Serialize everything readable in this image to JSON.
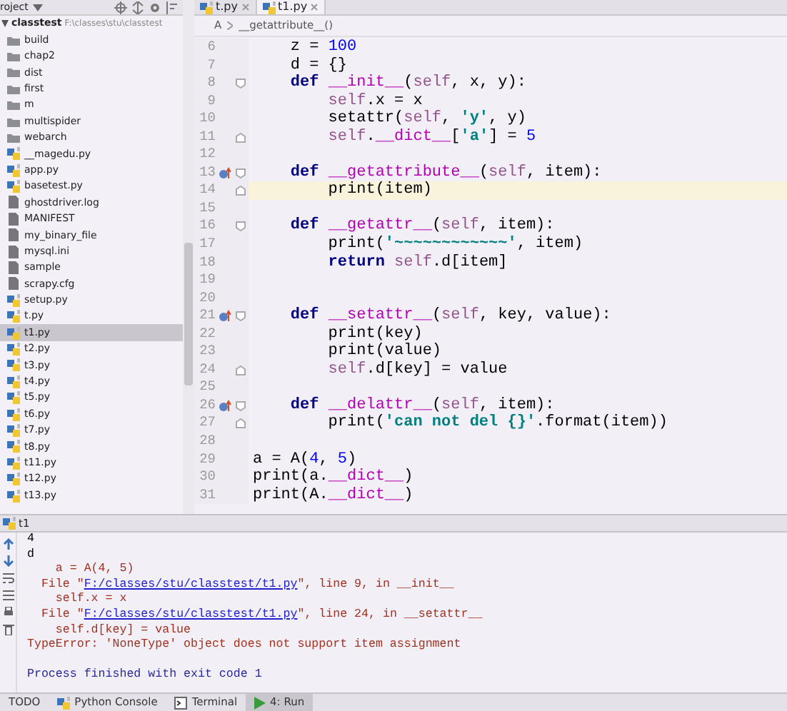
{
  "project": {
    "title": "roject",
    "root": {
      "label": "classtest",
      "path": "F:\\classes\\stu\\classtest",
      "expanded": true,
      "children": [
        {
          "label": "build",
          "kind": "folder",
          "selected": false
        },
        {
          "label": "chap2",
          "kind": "folder",
          "selected": false
        },
        {
          "label": "dist",
          "kind": "folder",
          "selected": false
        },
        {
          "label": "first",
          "kind": "folder",
          "selected": false
        },
        {
          "label": "m",
          "kind": "folder",
          "selected": false
        },
        {
          "label": "multispider",
          "kind": "folder",
          "selected": false
        },
        {
          "label": "webarch",
          "kind": "folder",
          "selected": false
        },
        {
          "label": "__magedu.py",
          "kind": "python",
          "selected": false
        },
        {
          "label": "app.py",
          "kind": "python",
          "selected": false
        },
        {
          "label": "basetest.py",
          "kind": "python",
          "selected": false
        },
        {
          "label": "ghostdriver.log",
          "kind": "file",
          "selected": false
        },
        {
          "label": "MANIFEST",
          "kind": "file",
          "selected": false
        },
        {
          "label": "my_binary_file",
          "kind": "file",
          "selected": false
        },
        {
          "label": "mysql.ini",
          "kind": "file",
          "selected": false
        },
        {
          "label": "sample",
          "kind": "file",
          "selected": false
        },
        {
          "label": "scrapy.cfg",
          "kind": "file",
          "selected": false
        },
        {
          "label": "setup.py",
          "kind": "python",
          "selected": false
        },
        {
          "label": "t.py",
          "kind": "python",
          "selected": false
        },
        {
          "label": "t1.py",
          "kind": "python",
          "selected": true
        },
        {
          "label": "t2.py",
          "kind": "python",
          "selected": false
        },
        {
          "label": "t3.py",
          "kind": "python",
          "selected": false
        },
        {
          "label": "t4.py",
          "kind": "python",
          "selected": false
        },
        {
          "label": "t5.py",
          "kind": "python",
          "selected": false
        },
        {
          "label": "t6.py",
          "kind": "python",
          "selected": false
        },
        {
          "label": "t7.py",
          "kind": "python",
          "selected": false
        },
        {
          "label": "t8.py",
          "kind": "python",
          "selected": false
        },
        {
          "label": "t11.py",
          "kind": "python",
          "selected": false
        },
        {
          "label": "t12.py",
          "kind": "python",
          "selected": false
        },
        {
          "label": "t13.py",
          "kind": "python",
          "selected": false
        }
      ]
    }
  },
  "editor": {
    "tabs": [
      {
        "label": "t.py",
        "selected": false
      },
      {
        "label": "t1.py",
        "selected": true
      }
    ],
    "breadcrumb": [
      "A",
      "__getattribute__()"
    ],
    "lines": [
      {
        "number": "6",
        "segments": [
          {
            "text": "    z = ",
            "kind": "plain"
          },
          {
            "text": "100",
            "kind": "number"
          }
        ]
      },
      {
        "number": "7",
        "segments": [
          {
            "text": "    d = {}",
            "kind": "plain"
          }
        ]
      },
      {
        "number": "8",
        "fold_start": true,
        "segments": [
          {
            "text": "    def",
            "kind": "keyword"
          },
          {
            "text": " __init__",
            "kind": "magic"
          },
          {
            "text": "(",
            "kind": "plain"
          },
          {
            "text": "self",
            "kind": "self"
          },
          {
            "text": ", x, y):",
            "kind": "plain"
          }
        ]
      },
      {
        "number": "9",
        "segments": [
          {
            "text": "        self",
            "kind": "self"
          },
          {
            "text": ".x = x",
            "kind": "plain"
          }
        ]
      },
      {
        "number": "10",
        "segments": [
          {
            "text": "        setattr(",
            "kind": "plain"
          },
          {
            "text": "self",
            "kind": "self"
          },
          {
            "text": ", ",
            "kind": "plain"
          },
          {
            "text": "'y'",
            "kind": "string"
          },
          {
            "text": ", y)",
            "kind": "plain"
          }
        ]
      },
      {
        "number": "11",
        "fold_end": true,
        "segments": [
          {
            "text": "        self",
            "kind": "self"
          },
          {
            "text": ".",
            "kind": "plain"
          },
          {
            "text": "__dict__",
            "kind": "magic"
          },
          {
            "text": "[",
            "kind": "plain"
          },
          {
            "text": "'a'",
            "kind": "string"
          },
          {
            "text": "] = ",
            "kind": "plain"
          },
          {
            "text": "5",
            "kind": "number"
          }
        ]
      },
      {
        "number": "12"
      },
      {
        "number": "13",
        "overrides": true,
        "fold_start": true,
        "segments": [
          {
            "text": "    def",
            "kind": "keyword"
          },
          {
            "text": " __getattribute__",
            "kind": "magic"
          },
          {
            "text": "(",
            "kind": "plain"
          },
          {
            "text": "self",
            "kind": "self"
          },
          {
            "text": ", item):",
            "kind": "plain"
          }
        ]
      },
      {
        "number": "14",
        "current": true,
        "fold_end": true,
        "segments": [
          {
            "text": "        print(item)",
            "kind": "plain"
          }
        ]
      },
      {
        "number": "15"
      },
      {
        "number": "16",
        "fold_start": true,
        "segments": [
          {
            "text": "    def",
            "kind": "keyword"
          },
          {
            "text": " __getattr__",
            "kind": "magic"
          },
          {
            "text": "(",
            "kind": "plain"
          },
          {
            "text": "self",
            "kind": "self"
          },
          {
            "text": ", item):",
            "kind": "plain"
          }
        ]
      },
      {
        "number": "17",
        "segments": [
          {
            "text": "        print(",
            "kind": "plain"
          },
          {
            "text": "'~~~~~~~~~~~~'",
            "kind": "string"
          },
          {
            "text": ", item)",
            "kind": "plain"
          }
        ]
      },
      {
        "number": "18",
        "segments": [
          {
            "text": "        return",
            "kind": "keyword"
          },
          {
            "text": " self",
            "kind": "self"
          },
          {
            "text": ".d[item]",
            "kind": "plain"
          }
        ]
      },
      {
        "number": "19"
      },
      {
        "number": "20"
      },
      {
        "number": "21",
        "overrides": true,
        "fold_start": true,
        "segments": [
          {
            "text": "    def",
            "kind": "keyword"
          },
          {
            "text": " __setattr__",
            "kind": "magic"
          },
          {
            "text": "(",
            "kind": "plain"
          },
          {
            "text": "self",
            "kind": "self"
          },
          {
            "text": ", key, value):",
            "kind": "plain"
          }
        ]
      },
      {
        "number": "22",
        "segments": [
          {
            "text": "        print(key)",
            "kind": "plain"
          }
        ]
      },
      {
        "number": "23",
        "segments": [
          {
            "text": "        print(value)",
            "kind": "plain"
          }
        ]
      },
      {
        "number": "24",
        "fold_end": true,
        "segments": [
          {
            "text": "        self",
            "kind": "self"
          },
          {
            "text": ".d[key] = value",
            "kind": "plain"
          }
        ]
      },
      {
        "number": "25"
      },
      {
        "number": "26",
        "overrides": true,
        "fold_start": true,
        "segments": [
          {
            "text": "    def",
            "kind": "keyword"
          },
          {
            "text": " __delattr__",
            "kind": "magic"
          },
          {
            "text": "(",
            "kind": "plain"
          },
          {
            "text": "self",
            "kind": "self"
          },
          {
            "text": ", item):",
            "kind": "plain"
          }
        ]
      },
      {
        "number": "27",
        "fold_end": true,
        "segments": [
          {
            "text": "        print(",
            "kind": "plain"
          },
          {
            "text": "'can not del {}'",
            "kind": "string"
          },
          {
            "text": ".format(item))",
            "kind": "plain"
          }
        ]
      },
      {
        "number": "28"
      },
      {
        "number": "29",
        "segments": [
          {
            "text": "a = A(",
            "kind": "plain"
          },
          {
            "text": "4",
            "kind": "number"
          },
          {
            "text": ", ",
            "kind": "plain"
          },
          {
            "text": "5",
            "kind": "number"
          },
          {
            "text": ")",
            "kind": "plain"
          }
        ]
      },
      {
        "number": "30",
        "segments": [
          {
            "text": "print(a.",
            "kind": "plain"
          },
          {
            "text": "__dict__",
            "kind": "magic"
          },
          {
            "text": ")",
            "kind": "plain"
          }
        ]
      },
      {
        "number": "31",
        "segments": [
          {
            "text": "print(A.",
            "kind": "plain"
          },
          {
            "text": "__dict__",
            "kind": "magic"
          },
          {
            "text": ")",
            "kind": "plain"
          }
        ]
      }
    ]
  },
  "run": {
    "title": "t1",
    "lines": [
      {
        "segments": [
          {
            "text": "4",
            "kind": "out"
          }
        ]
      },
      {
        "segments": [
          {
            "text": "d",
            "kind": "out"
          }
        ]
      },
      {
        "segments": [
          {
            "text": "    a = A(4, 5)",
            "kind": "err"
          }
        ]
      },
      {
        "segments": [
          {
            "text": "  File \"",
            "kind": "err"
          },
          {
            "text": "F:/classes/stu/classtest/t1.py",
            "kind": "link"
          },
          {
            "text": "\", line 9, in __init__",
            "kind": "err"
          }
        ]
      },
      {
        "segments": [
          {
            "text": "    self.x = x",
            "kind": "err"
          }
        ]
      },
      {
        "segments": [
          {
            "text": "  File \"",
            "kind": "err"
          },
          {
            "text": "F:/classes/stu/classtest/t1.py",
            "kind": "link"
          },
          {
            "text": "\", line 24, in __setattr__",
            "kind": "err"
          }
        ]
      },
      {
        "segments": [
          {
            "text": "    self.d[key] = value",
            "kind": "err"
          }
        ]
      },
      {
        "segments": [
          {
            "text": "TypeError: 'NoneType' object does not support item assignment",
            "kind": "err"
          }
        ]
      },
      {
        "status": true,
        "segments": [
          {
            "text": "Process finished with exit code 1",
            "kind": "info"
          }
        ]
      }
    ]
  },
  "bottom_bar": [
    {
      "label": "TODO",
      "kind": "plain",
      "selected": false
    },
    {
      "label": "Python Console",
      "kind": "python",
      "selected": false
    },
    {
      "label": "Terminal",
      "kind": "terminal",
      "selected": false
    },
    {
      "label": "4: Run",
      "kind": "run",
      "selected": true
    }
  ]
}
